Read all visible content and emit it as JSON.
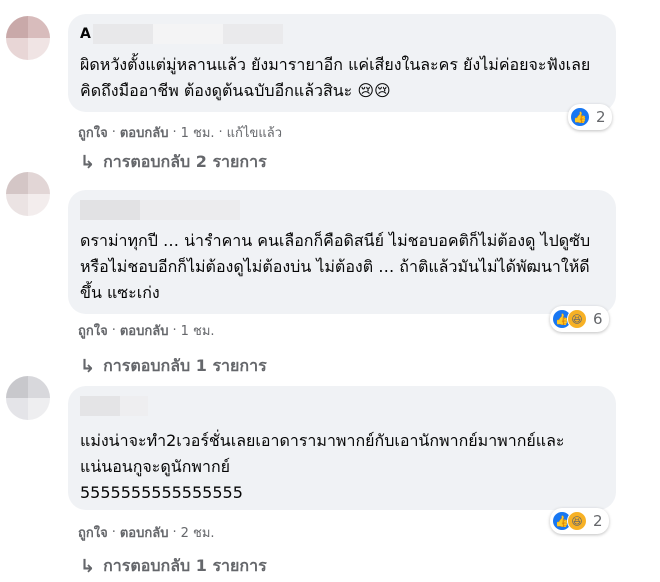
{
  "comments": [
    {
      "author": "A",
      "text": "ผิดหวังตั้งแต่มู่หลานแล้ว ยังมารายาอีก แค่เสียงในละคร ยังไม่ค่อยจะฟังเลย คิดถึงมืออาชีพ ต้องดูต้นฉบับอีกแล้วสินะ",
      "emoji": "😢😢",
      "meta": {
        "like": "ถูกใจ",
        "reply": "ตอบกลับ",
        "time": "1 ชม.",
        "edited": "แก้ไขแล้ว"
      },
      "reactions": {
        "count": "2",
        "types": [
          "like-icon"
        ]
      },
      "replies": "การตอบกลับ 2 รายการ",
      "avatar_colors": [
        "#c9a9a9",
        "#d8bcbc",
        "#e8d6d6",
        "#f0e4e4"
      ]
    },
    {
      "author": "",
      "text": "ดราม่าทุกปี … น่ารำคาน คนเลือกก็คือดิสนีย์ ไม่ชอบอคติก็ไม่ต้องดู ไปดูซับ หรือไม่ชอบอีกก็ไม่ต้องดูไม่ต้องบ่น ไม่ต้องติ … ถ้าติแล้วมันไม่ได้พัฒนาให้ดีขึ้น แซะเก่ง",
      "meta": {
        "like": "ถูกใจ",
        "reply": "ตอบกลับ",
        "time": "1 ชม."
      },
      "reactions": {
        "count": "6",
        "types": [
          "like-icon",
          "haha-icon"
        ]
      },
      "replies": "การตอบกลับ 1 รายการ",
      "avatar_colors": [
        "#d4c6c6",
        "#e2d6d6",
        "#ebe3e3",
        "#f3eded"
      ]
    },
    {
      "author": "",
      "text": "แม่งน่าจะทำ2เวอร์ชั่นเลยเอาดารามาพากย์กับเอานักพากย์มาพากย์และแน่นอนกูจะดูนักพากย์\n5555555555555555",
      "meta": {
        "like": "ถูกใจ",
        "reply": "ตอบกลับ",
        "time": "2 ชม."
      },
      "reactions": {
        "count": "2",
        "types": [
          "like-icon",
          "haha-icon"
        ]
      },
      "replies": "การตอบกลับ 1 รายการ",
      "avatar_colors": [
        "#c8c8cc",
        "#d8d8dc",
        "#e4e4e8",
        "#eeeef0"
      ]
    }
  ],
  "icons": {
    "reply_arrow": "↳"
  }
}
